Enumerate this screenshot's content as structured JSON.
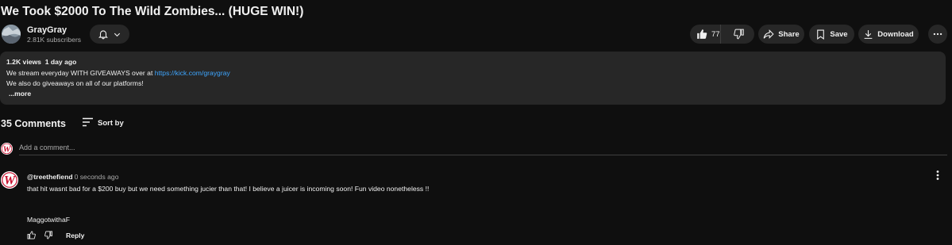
{
  "video": {
    "title": "We Took $2000 To The Wild Zombies... (HUGE WIN!)"
  },
  "channel": {
    "name": "GrayGray",
    "subscribers": "2.81K subscribers"
  },
  "actions": {
    "like_count": "77",
    "share_label": "Share",
    "save_label": "Save",
    "download_label": "Download"
  },
  "description": {
    "stats": "1.2K views  1 day ago",
    "line1_text": "We stream everyday WITH GIVEAWAYS over at ",
    "line1_link": "https://kick.com/graygray",
    "line2": "We also do giveaways on all of our platforms!",
    "more_label": "...more"
  },
  "comments": {
    "count_label": "35 Comments",
    "sort_label": "Sort by",
    "add_placeholder": "Add a comment...",
    "items": [
      {
        "author": "@treethefiend",
        "time": "0 seconds ago",
        "text": "that hit wasnt bad for a $200 buy but we need something jucier than that! I believe a juicer is incoming soon! Fun video nonetheless !!",
        "signature": "MaggotwithaF",
        "reply_label": "Reply"
      }
    ]
  },
  "colors": {
    "background": "#0f0f0f",
    "surface": "#272727",
    "link": "#3ea6ff",
    "avatar_red": "#c8102e"
  }
}
